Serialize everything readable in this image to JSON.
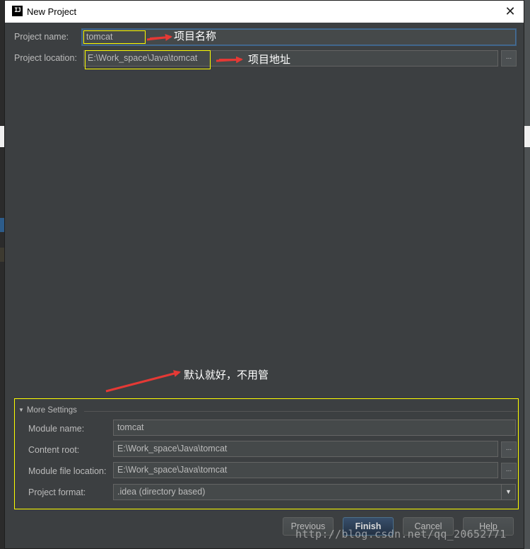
{
  "window": {
    "title": "New Project",
    "app_icon": "IJ",
    "close": "✕"
  },
  "project_name": {
    "label": "Project name:",
    "value": "tomcat"
  },
  "project_location": {
    "label": "Project location:",
    "value": "E:\\Work_space\\Java\\tomcat",
    "browse": "..."
  },
  "annotations": {
    "name_note": "项目名称",
    "location_note": "项目地址",
    "settings_note": "默认就好，不用管"
  },
  "more_settings": {
    "header": "More Settings",
    "module_name": {
      "label": "Module name:",
      "value": "tomcat"
    },
    "content_root": {
      "label": "Content root:",
      "value": "E:\\Work_space\\Java\\tomcat",
      "browse": "..."
    },
    "module_file_location": {
      "label": "Module file location:",
      "value": "E:\\Work_space\\Java\\tomcat",
      "browse": "..."
    },
    "project_format": {
      "label": "Project format:",
      "value": ".idea (directory based)",
      "arrow": "▼"
    }
  },
  "buttons": {
    "previous": "Previous",
    "finish": "Finish",
    "cancel": "Cancel",
    "help": "Help"
  },
  "watermark": "http://blog.csdn.net/qq_20652771",
  "colors": {
    "background": "#3c3f41",
    "highlight": "#ffff00",
    "arrow": "#e53935",
    "finish_button": "#365880"
  }
}
